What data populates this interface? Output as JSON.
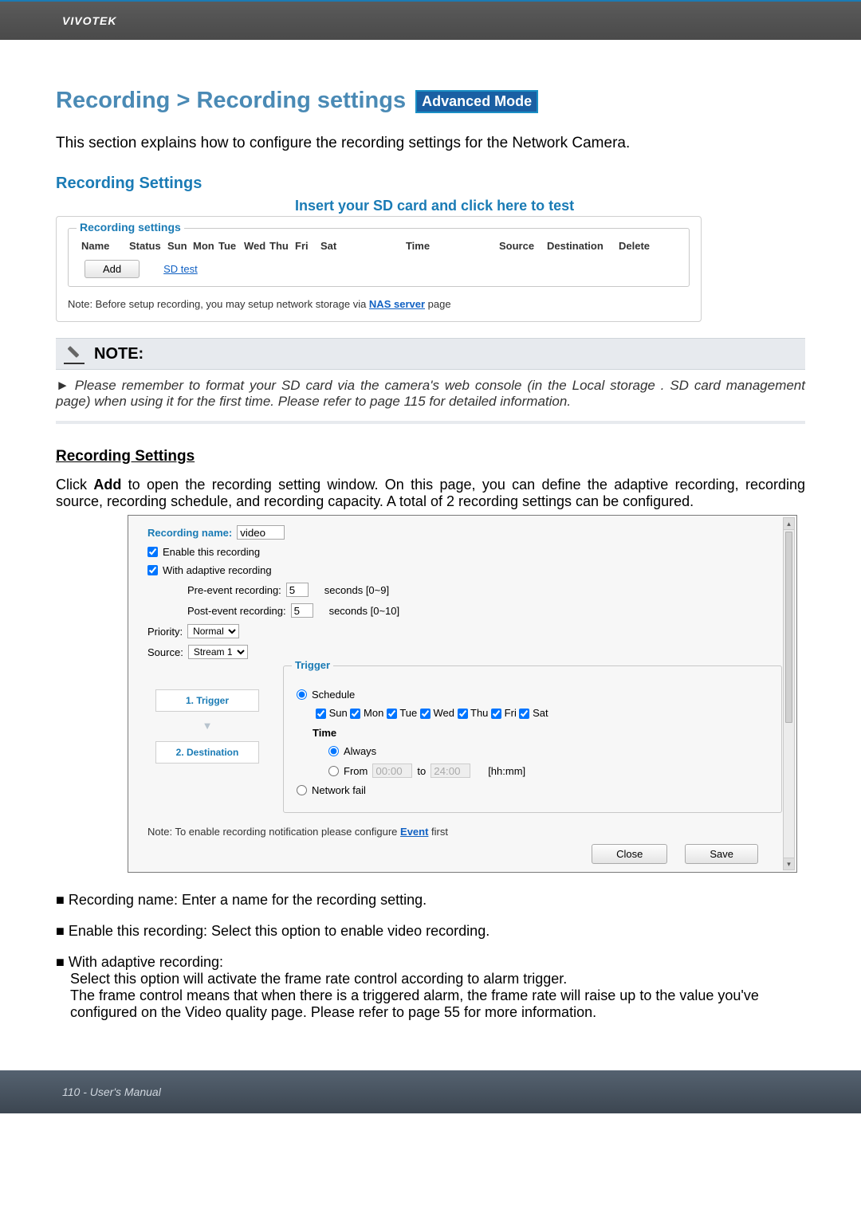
{
  "brand": "VIVOTEK",
  "title_prefix": "Recording > Recording settings",
  "badge": "Advanced Mode",
  "intro": "This section explains how to configure the recording settings for the Network Camera.",
  "section_title": "Recording Settings",
  "sd_hint": "Insert your SD card and click here to test",
  "fieldset_legend": "Recording settings",
  "table": {
    "cols": [
      "Name",
      "Status",
      "Sun",
      "Mon",
      "Tue",
      "Wed",
      "Thu",
      "Fri",
      "Sat",
      "Time",
      "Source",
      "Destination",
      "Delete"
    ]
  },
  "add_btn": "Add",
  "sd_test_link": "SD test",
  "nas_note_prefix": "Note: Before setup recording, you may setup network storage via ",
  "nas_note_link": "NAS server",
  "nas_note_suffix": " page",
  "notebox": {
    "title": "NOTE:",
    "body": "Please remember to format your SD card via the camera's web console (in the Local storage . SD card management page) when using it for the first time. Please refer to page 115 for detailed information."
  },
  "rs_heading": "Recording Settings",
  "rs_desc_prefix": "Click ",
  "rs_desc_bold": "Add",
  "rs_desc_suffix": " to open the recording setting window. On this page, you can define the adaptive recording, recording source, recording schedule, and recording capacity. A total of 2 recording settings can be configured.",
  "form": {
    "rec_name_label": "Recording name:",
    "rec_name_value": "video",
    "enable_label": "Enable this recording",
    "adaptive_label": "With adaptive recording",
    "pre_label": "Pre-event recording:",
    "pre_value": "5",
    "pre_hint": "seconds [0~9]",
    "post_label": "Post-event recording:",
    "post_value": "5",
    "post_hint": "seconds [0~10]",
    "priority_label": "Priority:",
    "priority_value": "Normal",
    "source_label": "Source:",
    "source_value": "Stream 1",
    "step1": "1. Trigger",
    "step2": "2. Destination",
    "trigger_legend": "Trigger",
    "schedule_label": "Schedule",
    "days": [
      "Sun",
      "Mon",
      "Tue",
      "Wed",
      "Thu",
      "Fri",
      "Sat"
    ],
    "time_label": "Time",
    "always_label": "Always",
    "from_label": "From",
    "from_value": "00:00",
    "to_label": "to",
    "to_value": "24:00",
    "hhmm": "[hh:mm]",
    "network_fail": "Network fail",
    "note2_prefix": "Note: To enable recording notification please configure ",
    "note2_link": "Event",
    "note2_suffix": " first",
    "close_btn": "Close",
    "save_btn": "Save"
  },
  "bullets": {
    "b1": "Recording name: Enter a name for the recording setting.",
    "b2": "Enable this recording: Select this option to enable video recording.",
    "b3_head": "With adaptive recording:",
    "b3_l1": "Select this option will activate the frame rate control according to alarm trigger.",
    "b3_l2": "The frame control means that when there is a triggered alarm, the frame rate will raise up to the value you've configured on the Video quality page. Please refer to page 55 for more information."
  },
  "footer": "110 - User's Manual"
}
